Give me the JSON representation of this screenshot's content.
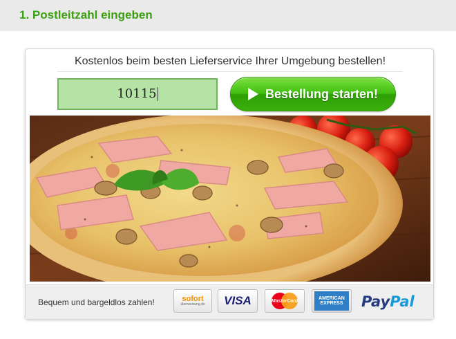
{
  "header": {
    "title": "1. Postleitzahl eingeben"
  },
  "card": {
    "headline": "Kostenlos beim besten Lieferservice Ihrer Umgebung bestellen!",
    "zip_value": "10115",
    "cta_label": "Bestellung starten!"
  },
  "payment": {
    "text": "Bequem und bargeldlos zahlen!",
    "sofort": {
      "brand": "sofort",
      "sub": "überweisung.de"
    },
    "visa": "VISA",
    "mastercard": "MasterCard",
    "amex": {
      "line1": "AMERICAN",
      "line2": "EXPRESS"
    },
    "paypal": {
      "part1": "Pay",
      "part2": "Pal"
    }
  },
  "colors": {
    "brand_green": "#3aa10f",
    "zip_fill": "#b5e3a5",
    "paypal_dark": "#253b80",
    "paypal_light": "#179bd7"
  }
}
